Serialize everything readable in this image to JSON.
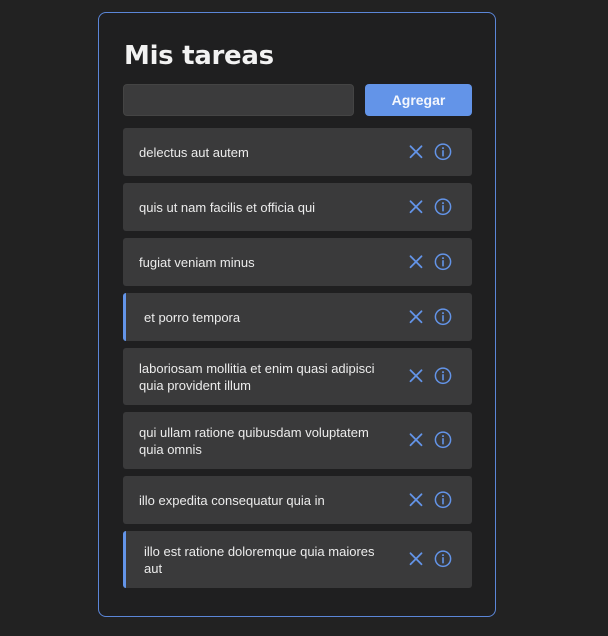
{
  "title": "Mis tareas",
  "input": {
    "value": "",
    "placeholder": ""
  },
  "add_button_label": "Agregar",
  "colors": {
    "accent": "#6394e8",
    "background": "#222222",
    "item_bg": "#3a3a3b"
  },
  "tasks": [
    {
      "text": "delectus aut autem",
      "active": false,
      "height": 48
    },
    {
      "text": "quis ut nam facilis et officia qui",
      "active": false,
      "height": 48
    },
    {
      "text": "fugiat veniam minus",
      "active": false,
      "height": 48
    },
    {
      "text": "et porro tempora",
      "active": true,
      "height": 48
    },
    {
      "text": "laboriosam mollitia et enim quasi adipisci quia provident illum",
      "active": false,
      "height": 57
    },
    {
      "text": "qui ullam ratione quibusdam voluptatem quia omnis",
      "active": false,
      "height": 57
    },
    {
      "text": "illo expedita consequatur quia in",
      "active": false,
      "height": 48
    },
    {
      "text": "illo est ratione doloremque quia maiores aut",
      "active": true,
      "height": 57
    }
  ],
  "icons": {
    "delete": "close-icon",
    "details": "info-icon"
  }
}
